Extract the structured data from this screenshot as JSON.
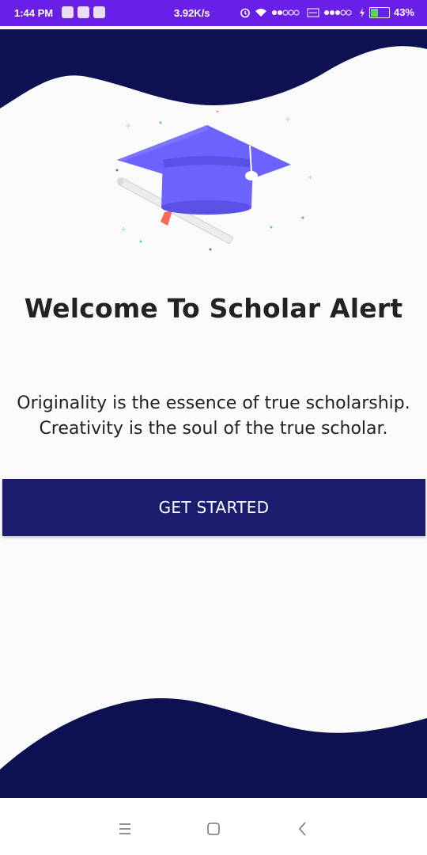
{
  "status_bar": {
    "time": "1:44 PM",
    "network_speed": "3.92K/s",
    "battery_level": "43%",
    "battery_fraction": 0.43,
    "icons": [
      "telegram-icon",
      "app-icon",
      "app-icon-2",
      "alarm-icon",
      "wifi-icon",
      "signal-icon",
      "volte-icon",
      "signal-icon-2",
      "charging-icon",
      "battery-icon"
    ]
  },
  "welcome": {
    "title": "Welcome To Scholar Alert",
    "quote_line1": "Originality is the essence of true scholarship.",
    "quote_line2": "Creativity is the soul of the true scholar."
  },
  "button": {
    "label": "GET STARTED"
  },
  "colors": {
    "status_bar": "#6a1fe6",
    "wave": "#0d1152",
    "button": "#1a1d6e",
    "cap": "#6c63ff",
    "tassel": "#f46b5e",
    "background": "#fafafa"
  },
  "nav_bar": {
    "icons": [
      "menu-icon",
      "home-icon",
      "back-icon"
    ]
  }
}
